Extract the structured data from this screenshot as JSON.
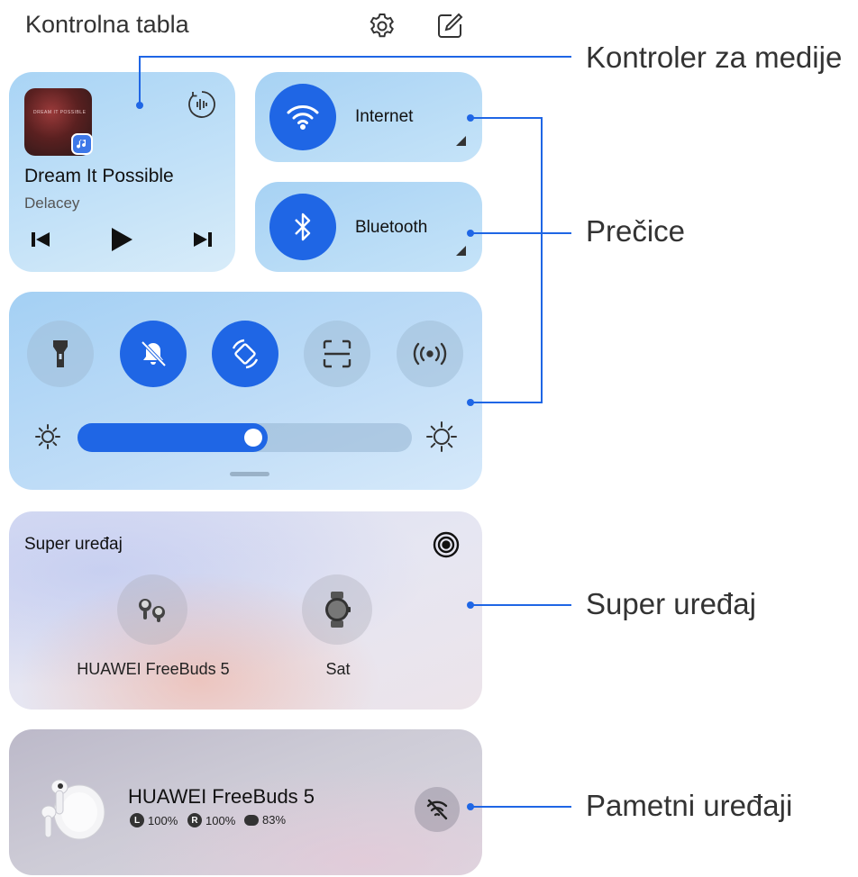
{
  "header": {
    "title": "Kontrolna tabla",
    "settings_icon": "gear-icon",
    "edit_icon": "edit-icon"
  },
  "media": {
    "song": "Dream It Possible",
    "artist": "Delacey",
    "album_caption": "DREAM IT POSSIBLE"
  },
  "shortcuts": {
    "internet_label": "Internet",
    "bluetooth_label": "Bluetooth"
  },
  "switches": [
    {
      "name": "flashlight",
      "state": "off"
    },
    {
      "name": "silent",
      "state": "on"
    },
    {
      "name": "auto-rotate",
      "state": "on"
    },
    {
      "name": "screenshot",
      "state": "off"
    },
    {
      "name": "hotspot",
      "state": "off"
    }
  ],
  "brightness": {
    "level": 0.57
  },
  "super_device": {
    "title": "Super uređaj",
    "devices": [
      {
        "label": "HUAWEI FreeBuds 5"
      },
      {
        "label": "Sat"
      }
    ]
  },
  "smart_device": {
    "name": "HUAWEI FreeBuds 5",
    "left_battery": "100%",
    "right_battery": "100%",
    "case_battery": "83%"
  },
  "callouts": {
    "media": "Kontroler za medije",
    "shortcuts": "Prečice",
    "super": "Super uređaj",
    "smart": "Pametni uređaji"
  },
  "colors": {
    "accent": "#1f66e5"
  }
}
